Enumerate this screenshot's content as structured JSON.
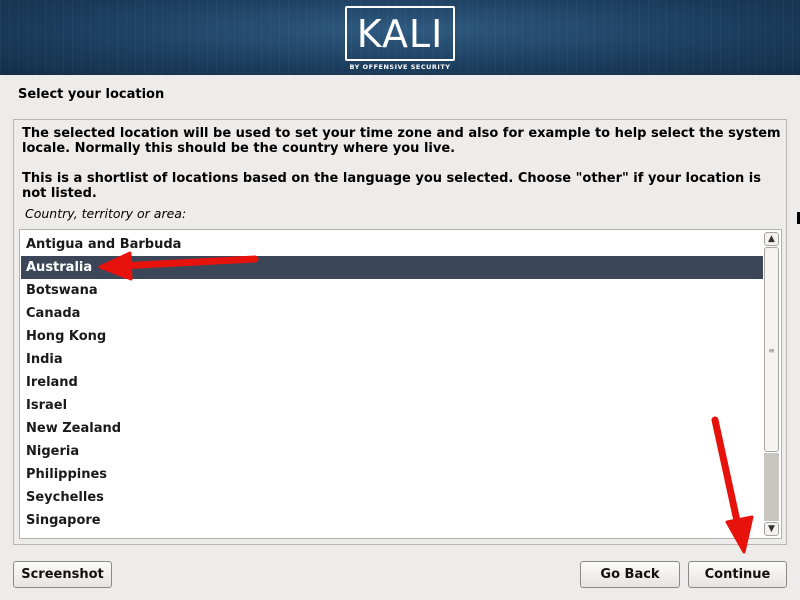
{
  "banner": {
    "logo_text": "KALI",
    "logo_subtext": "BY OFFENSIVE SECURITY"
  },
  "page_title": "Select your location",
  "description": {
    "paragraph1": "The selected location will be used to set your time zone and also for example to help select the system locale. Normally this should be the country where you live.",
    "paragraph2": "This is a shortlist of locations based on the language you selected. Choose \"other\" if your location is not listed."
  },
  "list": {
    "label": "Country, territory or area:",
    "items": [
      "Antigua and Barbuda",
      "Australia",
      "Botswana",
      "Canada",
      "Hong Kong",
      "India",
      "Ireland",
      "Israel",
      "New Zealand",
      "Nigeria",
      "Philippines",
      "Seychelles",
      "Singapore"
    ],
    "selected_index": 1
  },
  "scrollbar": {
    "up_glyph": "▲",
    "down_glyph": "▼",
    "grip_glyph": "≡"
  },
  "buttons": {
    "screenshot": "Screenshot",
    "go_back": "Go Back",
    "continue": "Continue"
  },
  "colors": {
    "selection": "#3b4759",
    "annotation_arrow": "#e8120c"
  }
}
